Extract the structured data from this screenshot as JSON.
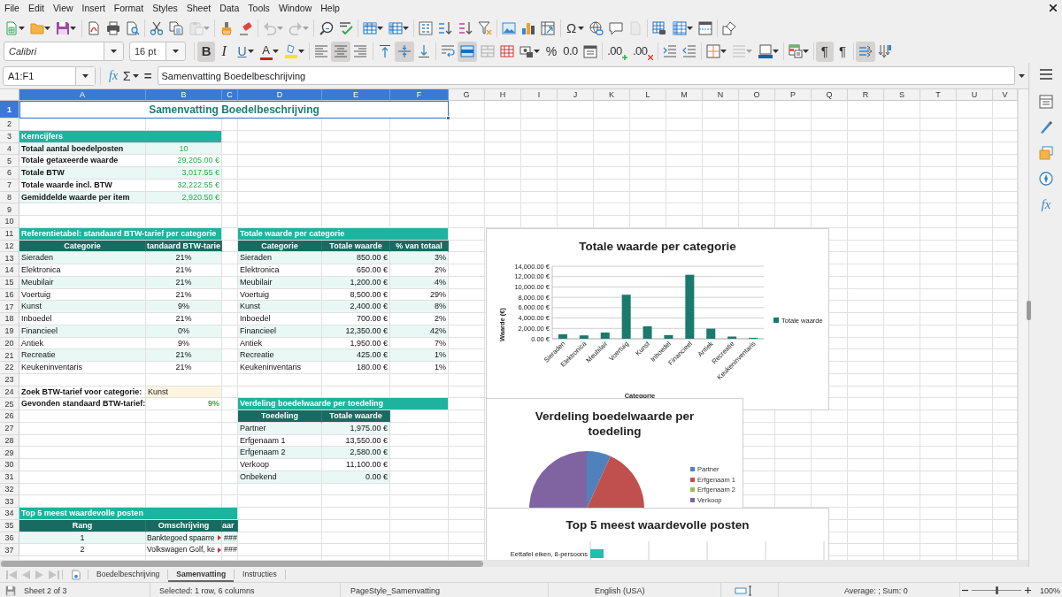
{
  "menu": [
    "File",
    "Edit",
    "View",
    "Insert",
    "Format",
    "Styles",
    "Sheet",
    "Data",
    "Tools",
    "Window",
    "Help"
  ],
  "standard_toolbar": [
    [
      {
        "kind": "new",
        "menu": true,
        "disabled": false
      },
      {
        "kind": "open",
        "menu": true,
        "disabled": false
      },
      {
        "kind": "save",
        "menu": true,
        "disabled": false
      }
    ],
    [
      {
        "kind": "pdf",
        "menu": false,
        "disabled": false
      },
      {
        "kind": "print",
        "menu": false,
        "disabled": false
      },
      {
        "kind": "preview",
        "menu": false,
        "disabled": false
      }
    ],
    [
      {
        "kind": "cut",
        "menu": false,
        "disabled": false
      },
      {
        "kind": "copy",
        "menu": false,
        "disabled": false
      },
      {
        "kind": "paste",
        "menu": true,
        "disabled": true
      }
    ],
    [
      {
        "kind": "clone",
        "menu": false,
        "disabled": false
      },
      {
        "kind": "clear",
        "menu": false,
        "disabled": false
      }
    ],
    [
      {
        "kind": "undo",
        "menu": true,
        "disabled": true
      },
      {
        "kind": "redo",
        "menu": true,
        "disabled": true
      }
    ],
    [
      {
        "kind": "find",
        "menu": false,
        "disabled": false
      },
      {
        "kind": "spelling",
        "menu": false,
        "disabled": false
      }
    ],
    [
      {
        "kind": "rows",
        "menu": true,
        "disabled": false
      },
      {
        "kind": "columns",
        "menu": true,
        "disabled": false
      }
    ],
    [
      {
        "kind": "sort",
        "menu": false,
        "disabled": false
      },
      {
        "kind": "ascending",
        "menu": false,
        "disabled": false
      },
      {
        "kind": "descending",
        "menu": false,
        "disabled": false
      },
      {
        "kind": "filter",
        "menu": false,
        "disabled": false
      }
    ],
    [
      {
        "kind": "image",
        "menu": false,
        "disabled": false
      },
      {
        "kind": "chart",
        "menu": false,
        "disabled": false
      },
      {
        "kind": "pivot",
        "menu": false,
        "disabled": false
      }
    ],
    [
      {
        "kind": "symbol",
        "label": "Ω",
        "menu": true,
        "disabled": false
      },
      {
        "kind": "hyperlink",
        "menu": false,
        "disabled": false
      },
      {
        "kind": "comment",
        "menu": false,
        "disabled": false
      },
      {
        "kind": "headerfooter",
        "menu": false,
        "disabled": true
      }
    ],
    [
      {
        "kind": "printarea",
        "menu": false,
        "disabled": false
      },
      {
        "kind": "freeze",
        "menu": true,
        "disabled": false
      },
      {
        "kind": "split",
        "menu": false,
        "disabled": false
      }
    ],
    [
      {
        "kind": "shapes",
        "menu": false,
        "disabled": false
      }
    ]
  ],
  "formatting_toolbar": {
    "font_name": "Calibri",
    "font_size": "16 pt",
    "groups": [
      [
        {
          "kind": "bold",
          "label": "B",
          "menu": false,
          "on": true,
          "disabled": false
        },
        {
          "kind": "italic",
          "label": "I",
          "menu": false,
          "on": false,
          "disabled": false
        },
        {
          "kind": "underline",
          "label": "U",
          "menu": true,
          "on": false,
          "disabled": false
        },
        {
          "kind": "fontcolor",
          "label": "A",
          "menu": true,
          "on": false,
          "disabled": false
        },
        {
          "kind": "highlight",
          "menu": true,
          "on": false,
          "disabled": false
        }
      ],
      [
        {
          "kind": "left",
          "menu": false,
          "on": false,
          "disabled": false
        },
        {
          "kind": "center",
          "menu": false,
          "on": true,
          "disabled": false
        },
        {
          "kind": "right",
          "menu": false,
          "on": false,
          "disabled": false
        }
      ],
      [
        {
          "kind": "top",
          "menu": false,
          "on": false,
          "disabled": false
        },
        {
          "kind": "middle",
          "menu": false,
          "on": true,
          "disabled": false
        },
        {
          "kind": "bottom",
          "menu": false,
          "on": false,
          "disabled": false
        }
      ],
      [
        {
          "kind": "wrap",
          "menu": false,
          "on": false,
          "disabled": false
        },
        {
          "kind": "mergecenter",
          "menu": false,
          "on": true,
          "disabled": false
        },
        {
          "kind": "merge",
          "menu": false,
          "on": false,
          "disabled": false
        },
        {
          "kind": "unmerge",
          "menu": false,
          "on": false,
          "disabled": false
        },
        {
          "kind": "currency",
          "menu": true,
          "on": false,
          "disabled": false
        },
        {
          "kind": "percent",
          "label": "%",
          "menu": false,
          "on": false,
          "disabled": false
        },
        {
          "kind": "number",
          "label": "0.0",
          "menu": false,
          "on": false,
          "disabled": false
        },
        {
          "kind": "date",
          "menu": false,
          "on": false,
          "disabled": false
        }
      ],
      [
        {
          "kind": "adddecimal",
          "label": ".00",
          "menu": false,
          "on": false,
          "disabled": false
        },
        {
          "kind": "deletedecimal",
          "label": ".00",
          "menu": false,
          "on": false,
          "disabled": false
        }
      ],
      [
        {
          "kind": "indent",
          "menu": false,
          "on": false,
          "disabled": false
        },
        {
          "kind": "outdent",
          "menu": false,
          "on": false,
          "disabled": false
        }
      ],
      [
        {
          "kind": "borders",
          "menu": true,
          "on": false,
          "disabled": false
        },
        {
          "kind": "borderstyle",
          "menu": true,
          "on": false,
          "disabled": true
        },
        {
          "kind": "bordercolor",
          "menu": true,
          "on": false,
          "disabled": false
        }
      ],
      [
        {
          "kind": "conditional",
          "menu": true,
          "on": false,
          "disabled": false
        }
      ],
      [
        {
          "kind": "ltr",
          "label": "¶",
          "menu": false,
          "on": true,
          "disabled": false
        },
        {
          "kind": "rtl",
          "label": "¶",
          "menu": false,
          "on": false,
          "disabled": false
        }
      ],
      [
        {
          "kind": "horizontal",
          "menu": false,
          "on": true,
          "disabled": false
        },
        {
          "kind": "vertical",
          "menu": false,
          "on": false,
          "disabled": false
        }
      ]
    ]
  },
  "formula_bar": {
    "name_box": "A1:F1",
    "wizard": "fx",
    "sum": "Σ",
    "equals": "=",
    "content": "Samenvatting Boedelbeschrijving"
  },
  "sheet": {
    "columns": [
      {
        "label": "A",
        "selected": true
      },
      {
        "label": "B",
        "selected": true
      },
      {
        "label": "C",
        "selected": true
      },
      {
        "label": "D",
        "selected": true
      },
      {
        "label": "E",
        "selected": true
      },
      {
        "label": "F",
        "selected": true
      },
      {
        "label": "G",
        "selected": false
      },
      {
        "label": "H",
        "selected": false
      },
      {
        "label": "I",
        "selected": false
      },
      {
        "label": "J",
        "selected": false
      },
      {
        "label": "K",
        "selected": false
      },
      {
        "label": "L",
        "selected": false
      },
      {
        "label": "M",
        "selected": false
      },
      {
        "label": "N",
        "selected": false
      },
      {
        "label": "O",
        "selected": false
      },
      {
        "label": "P",
        "selected": false
      },
      {
        "label": "Q",
        "selected": false
      },
      {
        "label": "R",
        "selected": false
      },
      {
        "label": "S",
        "selected": false
      },
      {
        "label": "T",
        "selected": false
      },
      {
        "label": "U",
        "selected": false
      },
      {
        "label": "V",
        "selected": false
      }
    ],
    "rows": [
      {
        "label": "1",
        "selected": true
      },
      {
        "label": "2",
        "selected": false
      },
      {
        "label": "3",
        "selected": false
      },
      {
        "label": "4",
        "selected": false
      },
      {
        "label": "5",
        "selected": false
      },
      {
        "label": "6",
        "selected": false
      },
      {
        "label": "7",
        "selected": false
      },
      {
        "label": "8",
        "selected": false
      },
      {
        "label": "9",
        "selected": false
      },
      {
        "label": "10",
        "selected": false
      },
      {
        "label": "11",
        "selected": false
      },
      {
        "label": "12",
        "selected": false
      },
      {
        "label": "13",
        "selected": false
      },
      {
        "label": "14",
        "selected": false
      },
      {
        "label": "15",
        "selected": false
      },
      {
        "label": "16",
        "selected": false
      },
      {
        "label": "17",
        "selected": false
      },
      {
        "label": "18",
        "selected": false
      },
      {
        "label": "19",
        "selected": false
      },
      {
        "label": "20",
        "selected": false
      },
      {
        "label": "21",
        "selected": false
      },
      {
        "label": "22",
        "selected": false
      },
      {
        "label": "23",
        "selected": false
      },
      {
        "label": "24",
        "selected": false
      },
      {
        "label": "25",
        "selected": false
      },
      {
        "label": "26",
        "selected": false
      },
      {
        "label": "27",
        "selected": false
      },
      {
        "label": "28",
        "selected": false
      },
      {
        "label": "29",
        "selected": false
      },
      {
        "label": "30",
        "selected": false
      },
      {
        "label": "31",
        "selected": false
      },
      {
        "label": "32",
        "selected": false
      },
      {
        "label": "33",
        "selected": false
      },
      {
        "label": "34",
        "selected": false
      },
      {
        "label": "35",
        "selected": false
      },
      {
        "label": "36",
        "selected": false
      },
      {
        "label": "37",
        "selected": false
      }
    ],
    "title": "Samenvatting Boedelbeschrijving",
    "key_figures": {
      "heading": "Kerncijfers",
      "items": [
        {
          "label": "Totaal aantal boedelposten",
          "value": "10",
          "kind": "count"
        },
        {
          "label": "Totale getaxeerde waarde",
          "value": "29,205.00 €",
          "kind": "amount"
        },
        {
          "label": "Totale BTW",
          "value": "3,017.55 €",
          "kind": "amount"
        },
        {
          "label": "Totale waarde incl. BTW",
          "value": "32,222.55 €",
          "kind": "amount"
        },
        {
          "label": "Gemiddelde waarde per item",
          "value": "2,920.50 €",
          "kind": "amount"
        }
      ]
    },
    "vat_reference": {
      "heading": "Referentietabel: standaard BTW-tarief per categorie",
      "columns": [
        "Categorie",
        "tandaard BTW-tarie"
      ],
      "rows": [
        [
          "Sieraden",
          "21%"
        ],
        [
          "Elektronica",
          "21%"
        ],
        [
          "Meubilair",
          "21%"
        ],
        [
          "Voertuig",
          "21%"
        ],
        [
          "Kunst",
          "9%"
        ],
        [
          "Inboedel",
          "21%"
        ],
        [
          "Financieel",
          "0%"
        ],
        [
          "Antiek",
          "9%"
        ],
        [
          "Recreatie",
          "21%"
        ],
        [
          "Keukeninventaris",
          "21%"
        ]
      ]
    },
    "category_totals": {
      "heading": "Totale waarde per categorie",
      "columns": [
        "Categorie",
        "Totale waarde",
        "% van totaal"
      ],
      "rows": [
        [
          "Sieraden",
          "850.00 €",
          "3%"
        ],
        [
          "Elektronica",
          "650.00 €",
          "2%"
        ],
        [
          "Meubilair",
          "1,200.00 €",
          "4%"
        ],
        [
          "Voertuig",
          "8,500.00 €",
          "29%"
        ],
        [
          "Kunst",
          "2,400.00 €",
          "8%"
        ],
        [
          "Inboedel",
          "700.00 €",
          "2%"
        ],
        [
          "Financieel",
          "12,350.00 €",
          "42%"
        ],
        [
          "Antiek",
          "1,950.00 €",
          "7%"
        ],
        [
          "Recreatie",
          "425.00 €",
          "1%"
        ],
        [
          "Keukeninventaris",
          "180.00 €",
          "1%"
        ]
      ]
    },
    "lookup": {
      "query_label": "Zoek BTW-tarief voor categorie:",
      "query_value": "Kunst",
      "result_label": "Gevonden standaard BTW-tarief:",
      "result_value": "9%"
    },
    "allocation": {
      "heading": "Verdeling boedelwaarde per toedeling",
      "columns": [
        "Toedeling",
        "Totale waarde"
      ],
      "rows": [
        [
          "Partner",
          "1,975.00 €"
        ],
        [
          "Erfgenaam 1",
          "13,550.00 €"
        ],
        [
          "Erfgenaam 2",
          "2,580.00 €"
        ],
        [
          "Verkoop",
          "11,100.00 €"
        ],
        [
          "Onbekend",
          "0.00 €"
        ]
      ]
    },
    "top5": {
      "heading": "Top 5 meest waardevolle posten",
      "columns": [
        "Rang",
        "Omschrijving",
        "aar"
      ],
      "rows": [
        {
          "rank": "1",
          "description": "Banktegoed spaarre",
          "value": "###",
          "overflow": true
        },
        {
          "rank": "2",
          "description": "Volkswagen Golf, ke",
          "value": "###",
          "overflow": true
        }
      ]
    },
    "charts": [
      {
        "chart_data": {
          "type": "bar",
          "title": "Totale waarde per categorie",
          "xlabel": "Categorie",
          "ylabel": "Waarde (€)",
          "categories": [
            "Sieraden",
            "Elektronica",
            "Meubilair",
            "Voertuig",
            "Kunst",
            "Inboedel",
            "Financieel",
            "Antiek",
            "Recreatie",
            "Keukeninventaris"
          ],
          "series": [
            {
              "name": "Totale waarde",
              "color": "#1a7a6b",
              "values": [
                850,
                650,
                1200,
                8500,
                2400,
                700,
                12350,
                1950,
                425,
                180
              ]
            }
          ],
          "ylim": [
            0,
            14000
          ],
          "yticks": [
            {
              "value": 0,
              "label": "0.00 €"
            },
            {
              "value": 2000,
              "label": "2,000.00 €"
            },
            {
              "value": 4000,
              "label": "4,000.00 €"
            },
            {
              "value": 6000,
              "label": "6,000.00 €"
            },
            {
              "value": 8000,
              "label": "8,000.00 €"
            },
            {
              "value": 10000,
              "label": "10,000.00 €"
            },
            {
              "value": 12000,
              "label": "12,000.00 €"
            },
            {
              "value": 14000,
              "label": "14,000.00 €"
            }
          ],
          "grid": true
        }
      },
      {
        "title": "Verdeling boedelwaarde per toedeling",
        "legend": [
          {
            "label": "Partner",
            "color": "#4f81bd"
          },
          {
            "label": "Erfgenaam 1",
            "color": "#c0504d"
          },
          {
            "label": "Erfgenaam 2",
            "color": "#9bbb59"
          },
          {
            "label": "Verkoop",
            "color": "#8064a2"
          }
        ]
      },
      {
        "title": "Top 5 meest waardevolle posten",
        "categories": [
          "Eettafel eiken, 8-persoons"
        ]
      }
    ]
  },
  "sidebar": {
    "items": [
      {
        "kind": "properties"
      },
      {
        "kind": "styles"
      },
      {
        "kind": "gallery"
      },
      {
        "kind": "navigator"
      },
      {
        "kind": "functions",
        "label": "fx"
      }
    ]
  },
  "sheet_tabs": {
    "tabs": [
      {
        "label": "Boedelbeschrijving",
        "selected": false
      },
      {
        "label": "Samenvatting",
        "selected": true
      },
      {
        "label": "Instructies",
        "selected": false
      }
    ]
  },
  "status_bar": {
    "sheet": "Sheet 2 of 3",
    "selection": "Selected: 1 row, 6 columns",
    "page_style": "PageStyle_Samenvatting",
    "language": "English (USA)",
    "summary": "Average: ; Sum: 0",
    "zoom": {
      "level": 0.5,
      "reading": "100%"
    }
  }
}
